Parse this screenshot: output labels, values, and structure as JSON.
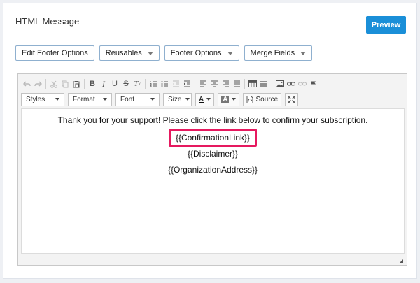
{
  "header": {
    "title": "HTML Message",
    "preview_label": "Preview"
  },
  "options": {
    "edit_footer_label": "Edit Footer Options",
    "reusables_label": "Reusables",
    "footer_options_label": "Footer Options",
    "merge_fields_label": "Merge Fields"
  },
  "toolbar": {
    "styles_label": "Styles",
    "format_label": "Format",
    "font_label": "Font",
    "size_label": "Size",
    "text_color_glyph": "A",
    "bg_color_glyph": "A",
    "source_label": "Source"
  },
  "content": {
    "line1": "Thank you for your support! Please click the link below to confirm your subscription.",
    "confirmation_link": "{{ConfirmationLink}}",
    "disclaimer": "{{Disclaimer}}",
    "organization_address": "{{OrganizationAddress}}"
  },
  "colors": {
    "preview_button": "#1a8fd8",
    "highlight_border": "#e6195f"
  }
}
